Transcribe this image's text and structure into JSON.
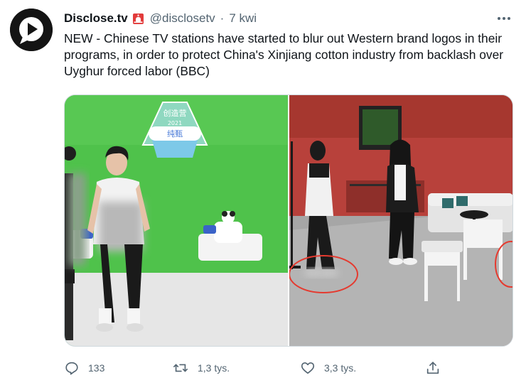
{
  "tweet": {
    "author_name": "Disclose.tv",
    "flag_icon": "siren-emoji-icon",
    "handle": "@disclosetv",
    "separator": "·",
    "time": "7 kwi",
    "more_icon": "more-dots-icon",
    "text": "NEW - Chinese TV stations have started to blur out Western brand logos in their programs, in order to protect China's Xinjiang cotton industry from backlash over Uyghur forced labor (BBC)"
  },
  "media": {
    "left_sign_text": "创造营",
    "left_sign_year": "2021",
    "left_sign_sub": "纯甄"
  },
  "actions": {
    "reply_count": "133",
    "retweet_count": "1,3 tys.",
    "like_count": "3,3 tys.",
    "reply_icon": "reply-icon",
    "retweet_icon": "retweet-icon",
    "like_icon": "heart-icon",
    "share_icon": "share-icon"
  },
  "colors": {
    "text": "#0f1419",
    "secondary": "#536471",
    "green_screen": "#4fc24b",
    "red_studio": "#b8413b"
  }
}
